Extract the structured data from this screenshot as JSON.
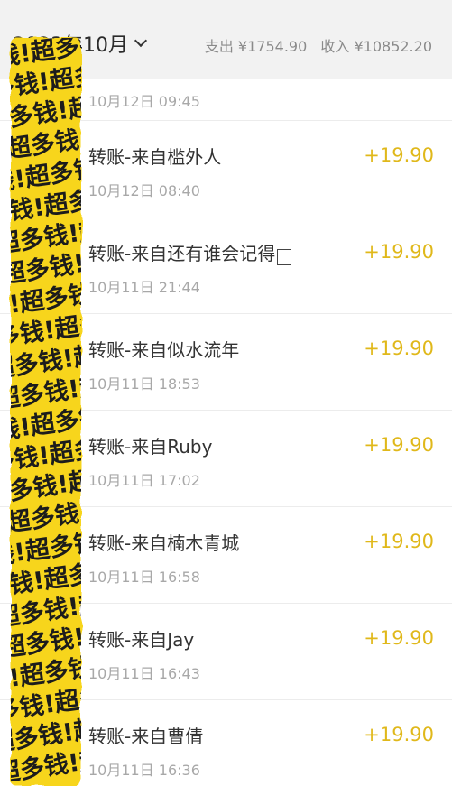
{
  "header": {
    "month_label": "2023年10月",
    "expense_label": "支出",
    "expense_value": "¥1754.90",
    "income_label": "收入",
    "income_value": "¥10852.20"
  },
  "sticker_text": "钱!超多钱!超多钱!超多",
  "transactions": [
    {
      "title": "",
      "time": "10月12日 09:45",
      "amount": ""
    },
    {
      "title": "转账-来自槛外人",
      "time": "10月12日 08:40",
      "amount": "+19.90"
    },
    {
      "title": "转账-来自还有谁会记得",
      "time": "10月11日 21:44",
      "amount": "+19.90"
    },
    {
      "title": "转账-来自似水流年",
      "time": "10月11日 18:53",
      "amount": "+19.90"
    },
    {
      "title": "转账-来自Ruby",
      "time": "10月11日 17:02",
      "amount": "+19.90"
    },
    {
      "title": "转账-来自楠木青城",
      "time": "10月11日 16:58",
      "amount": "+19.90"
    },
    {
      "title": "转账-来自Jay",
      "time": "10月11日 16:43",
      "amount": "+19.90"
    },
    {
      "title": "转账-来自曹倩",
      "time": "10月11日 16:36",
      "amount": "+19.90"
    }
  ],
  "colors": {
    "amount": "#e0b81a",
    "sticker_yellow": "#f7d51d",
    "background": "#f2f2f2"
  }
}
